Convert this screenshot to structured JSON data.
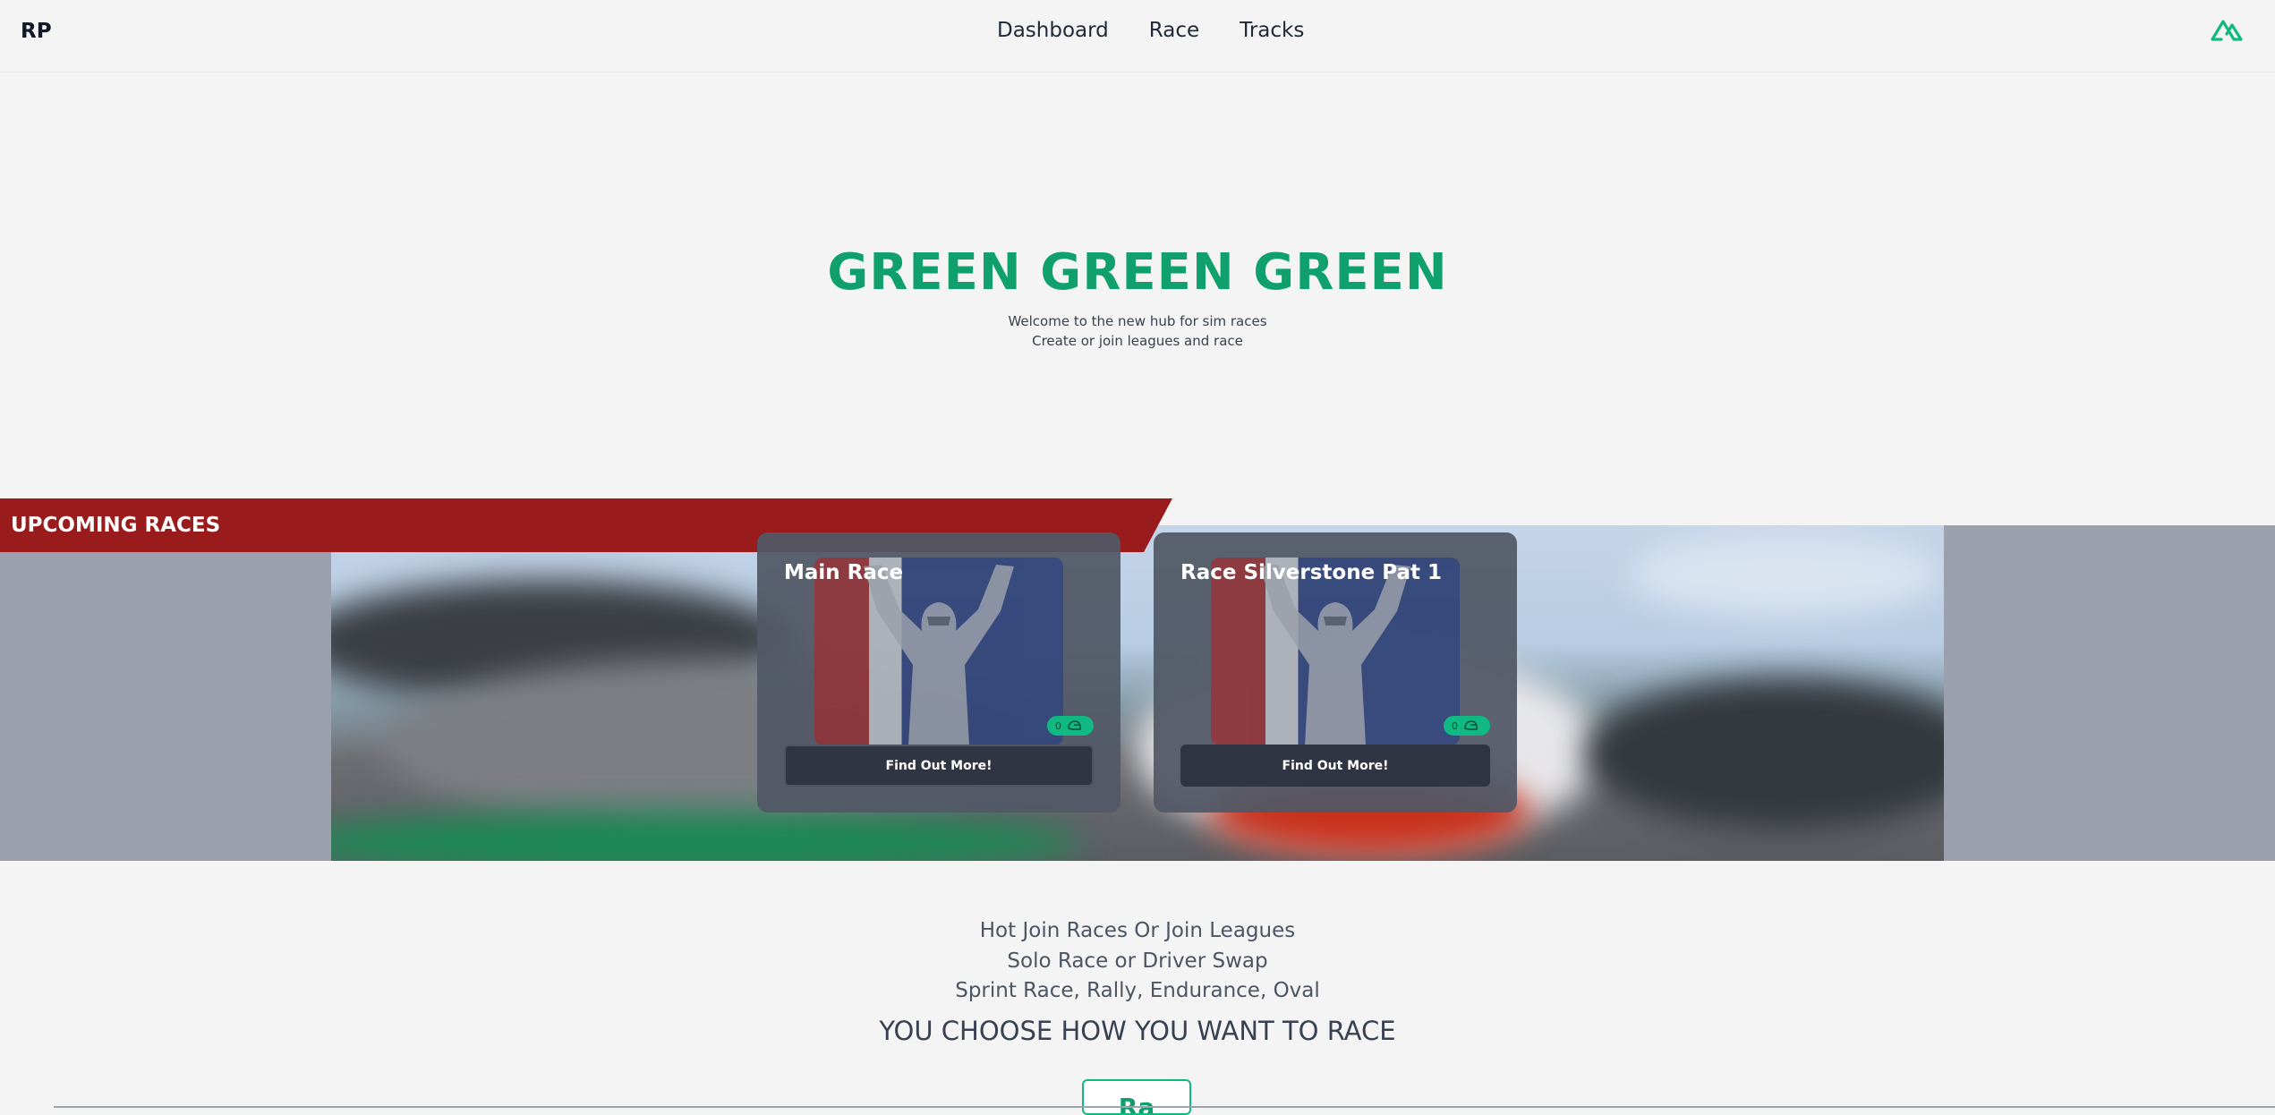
{
  "nav": {
    "brand": "RP",
    "links": [
      "Dashboard",
      "Race",
      "Tracks"
    ],
    "logo_icon": "nuxt-logo-icon"
  },
  "hero": {
    "title": "GREEN GREEN GREEN",
    "subtitle_lines": [
      "Welcome to the new hub for sim races",
      "Create or join leagues and race"
    ]
  },
  "upcoming": {
    "heading": "UPCOMING RACES",
    "cards": [
      {
        "title": "Main Race",
        "badge_count": "0",
        "badge_icon": "helmet-icon",
        "button": "Find Out More!"
      },
      {
        "title": "Race Silverstone Pat 1",
        "badge_count": "0",
        "badge_icon": "helmet-icon",
        "button": "Find Out More!"
      }
    ]
  },
  "pitch": {
    "lines": [
      "Hot Join Races Or Join Leagues",
      "Solo Race or Driver Swap",
      "Sprint Race, Rally, Endurance, Oval"
    ],
    "headline": "YOU CHOOSE HOW YOU WANT TO RACE",
    "cta_partial": "Ra"
  },
  "colors": {
    "accent": "#0fa06e",
    "ribbon": "#991b1b",
    "card": "#525866",
    "badge": "#10b981"
  }
}
